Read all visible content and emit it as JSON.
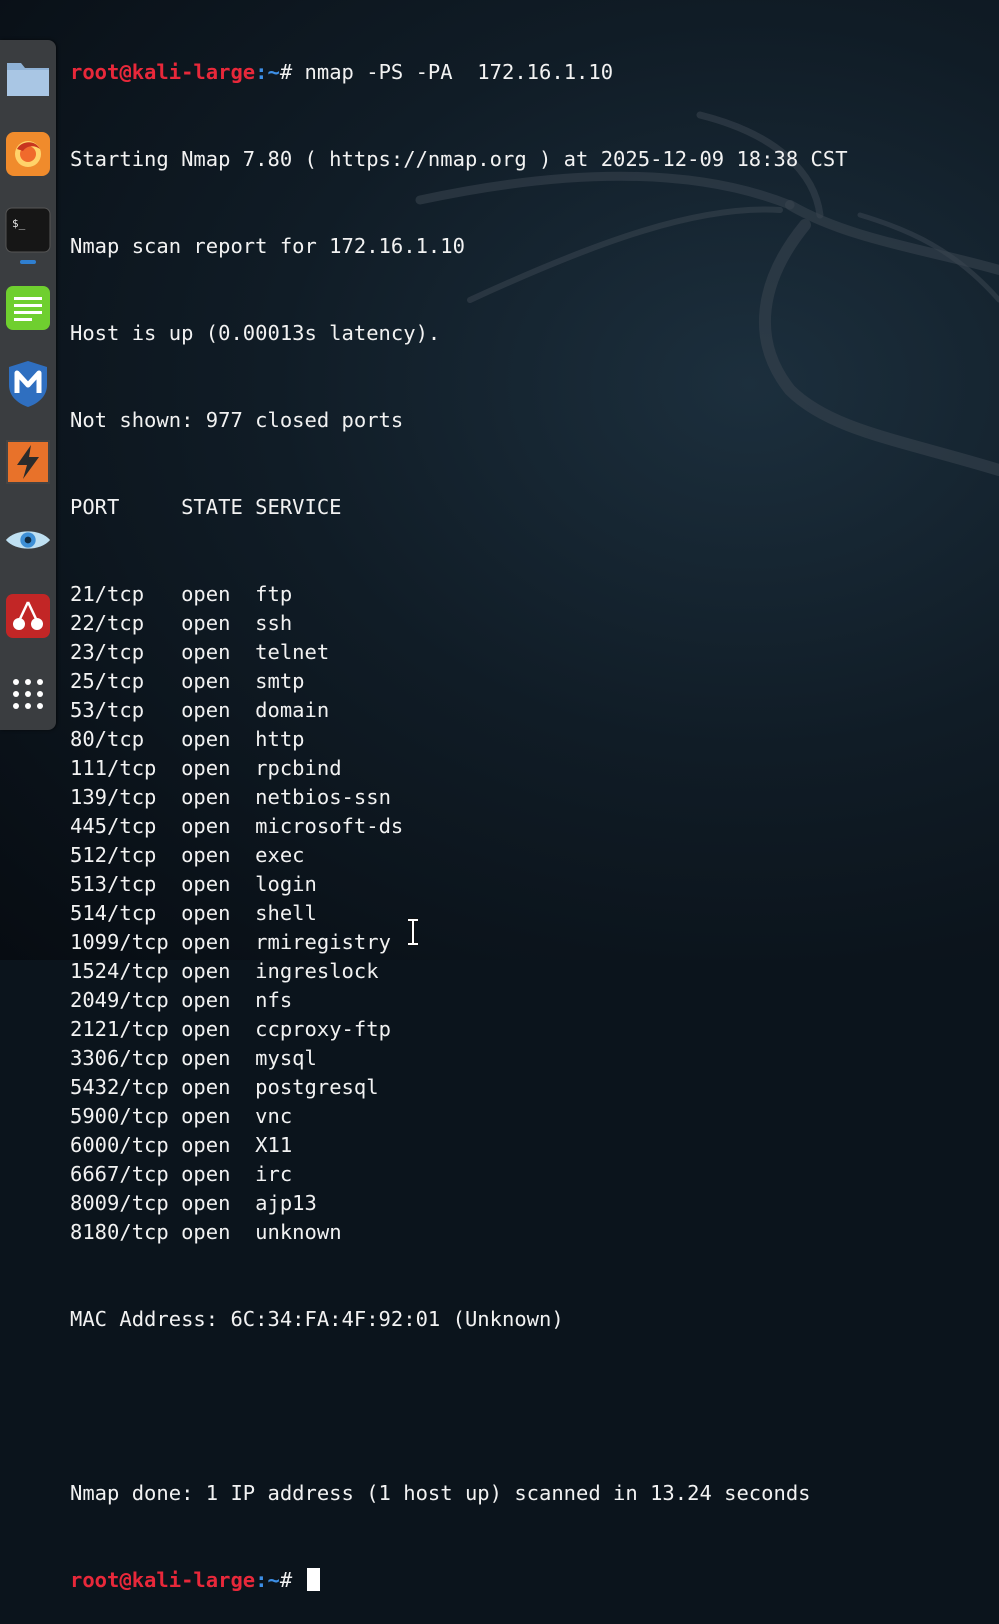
{
  "dock": {
    "items": [
      {
        "id": "files",
        "icon": "folder-icon"
      },
      {
        "id": "firefox",
        "icon": "firefox-icon"
      },
      {
        "id": "terminal",
        "icon": "terminal-icon",
        "glyph": "$_",
        "active": true
      },
      {
        "id": "notes",
        "icon": "text-editor-icon"
      },
      {
        "id": "metasploit",
        "icon": "metasploit-icon",
        "glyph": "M"
      },
      {
        "id": "burp",
        "icon": "burpsuite-icon"
      },
      {
        "id": "recon",
        "icon": "eye-icon"
      },
      {
        "id": "cherrytree",
        "icon": "cherry-icon"
      },
      {
        "id": "apps",
        "icon": "app-grid-icon"
      }
    ]
  },
  "prompt": {
    "user_host": "root@kali-large",
    "path": ":~",
    "symbol": "# "
  },
  "command": "nmap -PS -PA  172.16.1.10",
  "header_lines": [
    "Starting Nmap 7.80 ( https://nmap.org ) at 2025-12-09 18:38 CST",
    "Nmap scan report for 172.16.1.10",
    "Host is up (0.00013s latency).",
    "Not shown: 977 closed ports"
  ],
  "table_header": "PORT     STATE SERVICE",
  "ports": [
    {
      "port": "21/tcp",
      "state": "open",
      "service": "ftp"
    },
    {
      "port": "22/tcp",
      "state": "open",
      "service": "ssh"
    },
    {
      "port": "23/tcp",
      "state": "open",
      "service": "telnet"
    },
    {
      "port": "25/tcp",
      "state": "open",
      "service": "smtp"
    },
    {
      "port": "53/tcp",
      "state": "open",
      "service": "domain"
    },
    {
      "port": "80/tcp",
      "state": "open",
      "service": "http"
    },
    {
      "port": "111/tcp",
      "state": "open",
      "service": "rpcbind"
    },
    {
      "port": "139/tcp",
      "state": "open",
      "service": "netbios-ssn"
    },
    {
      "port": "445/tcp",
      "state": "open",
      "service": "microsoft-ds"
    },
    {
      "port": "512/tcp",
      "state": "open",
      "service": "exec"
    },
    {
      "port": "513/tcp",
      "state": "open",
      "service": "login"
    },
    {
      "port": "514/tcp",
      "state": "open",
      "service": "shell"
    },
    {
      "port": "1099/tcp",
      "state": "open",
      "service": "rmiregistry"
    },
    {
      "port": "1524/tcp",
      "state": "open",
      "service": "ingreslock"
    },
    {
      "port": "2049/tcp",
      "state": "open",
      "service": "nfs"
    },
    {
      "port": "2121/tcp",
      "state": "open",
      "service": "ccproxy-ftp"
    },
    {
      "port": "3306/tcp",
      "state": "open",
      "service": "mysql"
    },
    {
      "port": "5432/tcp",
      "state": "open",
      "service": "postgresql"
    },
    {
      "port": "5900/tcp",
      "state": "open",
      "service": "vnc"
    },
    {
      "port": "6000/tcp",
      "state": "open",
      "service": "X11"
    },
    {
      "port": "6667/tcp",
      "state": "open",
      "service": "irc"
    },
    {
      "port": "8009/tcp",
      "state": "open",
      "service": "ajp13"
    },
    {
      "port": "8180/tcp",
      "state": "open",
      "service": "unknown"
    }
  ],
  "mac_line": "MAC Address: 6C:34:FA:4F:92:01 (Unknown)",
  "done_line": "Nmap done: 1 IP address (1 host up) scanned in 13.24 seconds",
  "colors": {
    "user_host": "#e8283a",
    "path": "#3d8fe6",
    "text": "#f2f2f2"
  }
}
